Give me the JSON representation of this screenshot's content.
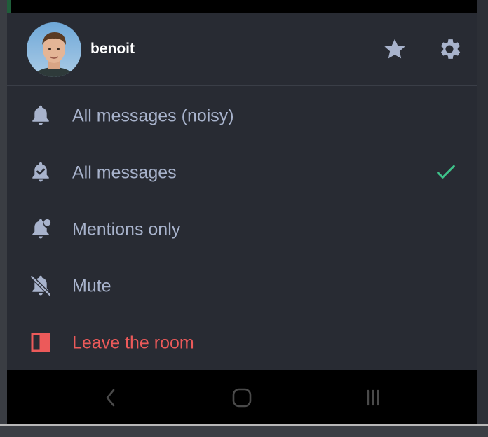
{
  "room_menu": {
    "user": {
      "name": "benoit",
      "avatar_icon": "user-avatar-photo"
    },
    "header_actions": [
      {
        "icon": "star-icon"
      },
      {
        "icon": "gear-icon"
      }
    ],
    "items": [
      {
        "label": "All messages (noisy)",
        "icon": "bell-icon",
        "selected": false
      },
      {
        "label": "All messages",
        "icon": "bell-check-icon",
        "selected": true
      },
      {
        "label": "Mentions only",
        "icon": "bell-dot-icon",
        "selected": false
      },
      {
        "label": "Mute",
        "icon": "bell-off-icon",
        "selected": false
      },
      {
        "label": "Leave the room",
        "icon": "leave-door-icon",
        "selected": false
      }
    ]
  },
  "nav_bar": {
    "buttons": [
      {
        "icon": "back-chevron-icon"
      },
      {
        "icon": "home-icon"
      },
      {
        "icon": "recents-icon"
      }
    ]
  },
  "colors": {
    "sheet_background": "#282b33",
    "text": "#a8b3cc",
    "danger": "#ec5a5a",
    "check": "#3ec28a",
    "icon": "#a8b3cc"
  }
}
